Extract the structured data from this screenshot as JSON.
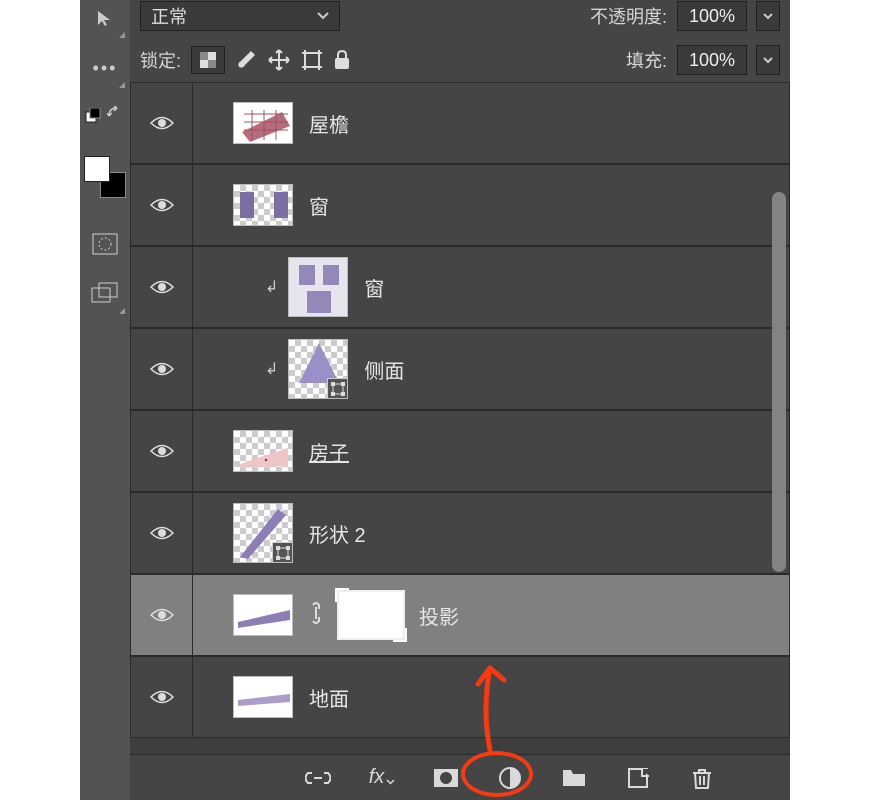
{
  "header": {
    "blend_mode": "正常",
    "opacity_label": "不透明度:",
    "opacity_value": "100%",
    "lock_label": "锁定:",
    "fill_label": "填充:",
    "fill_value": "100%"
  },
  "layers": [
    {
      "name": "屋檐",
      "indent": 0,
      "selected": false,
      "mask": false,
      "clip": false,
      "shape": false,
      "underline": false,
      "thumbStyle": "roof"
    },
    {
      "name": "窗",
      "indent": 0,
      "selected": false,
      "mask": false,
      "clip": false,
      "shape": false,
      "underline": false,
      "thumbStyle": "window"
    },
    {
      "name": "窗",
      "indent": 1,
      "selected": false,
      "mask": false,
      "clip": true,
      "shape": false,
      "underline": false,
      "thumbStyle": "window2"
    },
    {
      "name": "侧面",
      "indent": 1,
      "selected": false,
      "mask": false,
      "clip": true,
      "shape": true,
      "underline": false,
      "thumbStyle": "side"
    },
    {
      "name": "房子",
      "indent": 0,
      "selected": false,
      "mask": false,
      "clip": false,
      "shape": false,
      "underline": true,
      "thumbStyle": "house"
    },
    {
      "name": "形状 2",
      "indent": 0,
      "selected": false,
      "mask": false,
      "clip": false,
      "shape": true,
      "underline": false,
      "thumbStyle": "shape2"
    },
    {
      "name": "投影",
      "indent": 0,
      "selected": true,
      "mask": true,
      "clip": false,
      "shape": false,
      "underline": false,
      "thumbStyle": "shadow"
    },
    {
      "name": "地面",
      "indent": 0,
      "selected": false,
      "mask": false,
      "clip": false,
      "shape": false,
      "underline": false,
      "thumbStyle": "ground"
    }
  ],
  "bottombar": {
    "buttons": [
      "link",
      "fx",
      "mask",
      "adjustment",
      "group",
      "new",
      "trash"
    ]
  }
}
